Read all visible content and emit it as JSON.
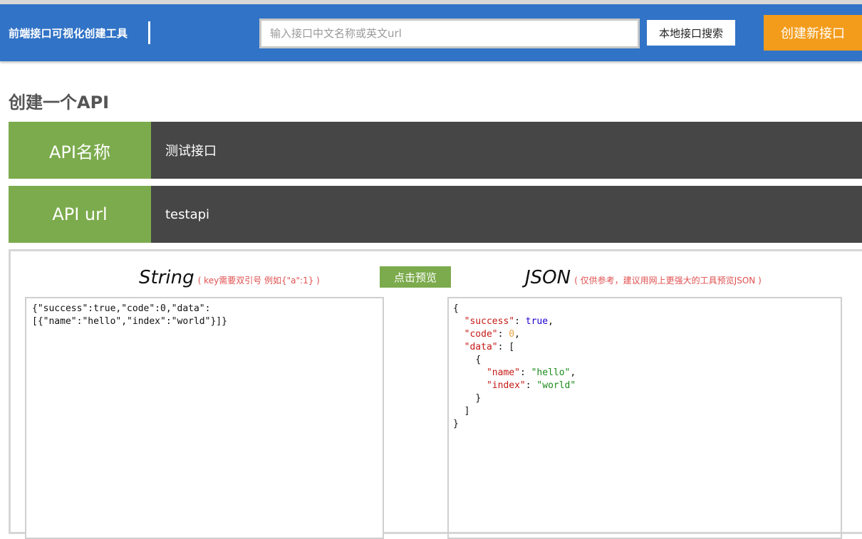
{
  "header": {
    "brand": "前端接口可视化创建工具",
    "search_placeholder": "输入接口中文名称或英文url",
    "search_button": "本地接口搜索",
    "create_button": "创建新接口"
  },
  "page_title": "创建一个API",
  "form": {
    "name_label": "API名称",
    "name_value": "测试接口",
    "url_label": "API url",
    "url_value": "testapi"
  },
  "editor": {
    "string_title": "String",
    "string_hint": "( key需要双引号 例如{\"a\":1} )",
    "preview_button": "点击预览",
    "json_title": "JSON",
    "json_hint": "( 仅供参考，建议用网上更强大的工具预览JSON )",
    "string_value": "{\"success\":true,\"code\":0,\"data\":[{\"name\":\"hello\",\"index\":\"world\"}]}",
    "json_tokens": {
      "open_brace": "{",
      "success_key": "\"success\"",
      "success_value": "true",
      "code_key": "\"code\"",
      "code_value": "0",
      "data_key": "\"data\"",
      "open_bracket": "[",
      "item_open": "{",
      "name_key": "\"name\"",
      "name_value": "\"hello\"",
      "index_key": "\"index\"",
      "index_value": "\"world\"",
      "item_close": "}",
      "close_bracket": "]",
      "close_brace": "}"
    }
  },
  "colors": {
    "header_bg": "#3173c6",
    "accent_orange": "#f39c1b",
    "label_green": "#7cab4d",
    "field_dark": "#464646"
  }
}
